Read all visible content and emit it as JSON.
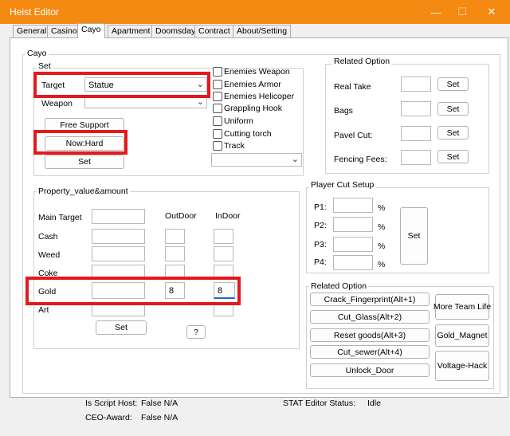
{
  "window": {
    "title": "Heist Editor",
    "minimize_glyph": "—",
    "maximize_glyph": "☐",
    "close_glyph": "✕"
  },
  "tabs": [
    {
      "label": "General"
    },
    {
      "label": "Casino"
    },
    {
      "label": "Cayo"
    },
    {
      "label": "Apartment"
    },
    {
      "label": "Doomsday"
    },
    {
      "label": "Contract"
    },
    {
      "label": "About/Setting"
    }
  ],
  "active_tab": "Cayo",
  "cayo": {
    "group_title": "Cayo",
    "set_group": {
      "title": "Set",
      "target_label": "Target",
      "target_value": "Statue",
      "weapon_label": "Weapon",
      "weapon_value": "",
      "free_support_button": "Free Support",
      "difficulty_button": "Now:Hard",
      "set_button": "Set"
    },
    "checkboxes": [
      {
        "label": "Enemies Weapon",
        "checked": false
      },
      {
        "label": "Enemies Armor",
        "checked": false
      },
      {
        "label": "Enemies Helicoper",
        "checked": false
      },
      {
        "label": "Grappling Hook",
        "checked": false
      },
      {
        "label": "Uniform",
        "checked": false
      },
      {
        "label": "Cutting torch",
        "checked": false
      },
      {
        "label": "Track",
        "checked": false
      }
    ],
    "extra_combo_value": "",
    "related_option_top": {
      "title": "Related Option",
      "rows": [
        {
          "label": "Real Take",
          "value": "",
          "button": "Set"
        },
        {
          "label": "Bags",
          "value": "",
          "button": "Set"
        },
        {
          "label": "Pavel Cut:",
          "value": "",
          "button": "Set"
        },
        {
          "label": "Fencing Fees:",
          "value": "",
          "button": "Set"
        }
      ]
    },
    "property": {
      "title": "Property_value&amount",
      "outdoor_header": "OutDoor",
      "indoor_header": "InDoor",
      "rows": [
        {
          "label": "Main Target",
          "value": "",
          "outdoor": null,
          "indoor": null
        },
        {
          "label": "Cash",
          "value": "",
          "outdoor": "",
          "indoor": ""
        },
        {
          "label": "Weed",
          "value": "",
          "outdoor": "",
          "indoor": ""
        },
        {
          "label": "Coke",
          "value": "",
          "outdoor": "",
          "indoor": ""
        },
        {
          "label": "Gold",
          "value": "",
          "outdoor": "8",
          "indoor": "8"
        },
        {
          "label": "Art",
          "value": "",
          "outdoor": null,
          "indoor": ""
        }
      ],
      "set_button": "Set",
      "help_button": "?"
    },
    "player_cut": {
      "title": "Player Cut Setup",
      "rows": [
        {
          "label": "P1:",
          "value": "",
          "unit": "%"
        },
        {
          "label": "P2:",
          "value": "",
          "unit": "%"
        },
        {
          "label": "P3:",
          "value": "",
          "unit": "%"
        },
        {
          "label": "P4:",
          "value": "",
          "unit": "%"
        }
      ],
      "set_button": "Set"
    },
    "related_option_bottom": {
      "title": "Related Option",
      "left_buttons": [
        "Crack_Fingerprint(Alt+1)",
        "Cut_Glass(Alt+2)",
        "Reset goods(Alt+3)",
        "Cut_sewer(Alt+4)",
        "Unlock_Door"
      ],
      "right_buttons": [
        "More Team Life",
        "Gold_Magnet",
        "Voltage-Hack"
      ]
    }
  },
  "status": {
    "script_host_label": "Is Script Host:",
    "script_host_value": "False N/A",
    "ceo_award_label": "CEO-Award:",
    "ceo_award_value": "False N/A",
    "stat_editor_label": "STAT Editor Status:",
    "stat_editor_value": "Idle"
  },
  "colors": {
    "titlebar": "#f58a12",
    "highlight_red": "#e3191e",
    "focus_blue": "#1e66c8"
  }
}
